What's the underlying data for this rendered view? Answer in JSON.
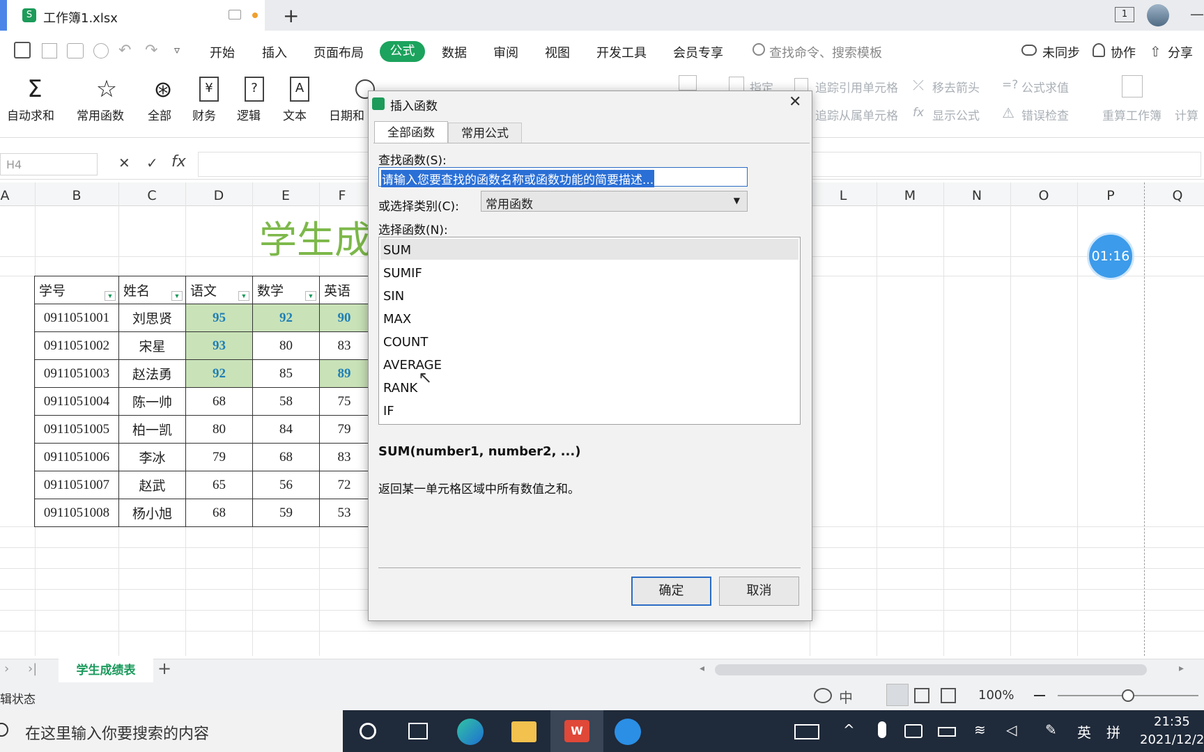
{
  "app": {
    "doc_badge": "S",
    "file_name": "工作簿1.xlsx",
    "new_tab": "+"
  },
  "title_right": {
    "page_indicator": "1",
    "minimize": "—"
  },
  "menu": {
    "items": [
      "开始",
      "插入",
      "页面布局",
      "公式",
      "数据",
      "审阅",
      "视图",
      "开发工具",
      "会员专享"
    ],
    "active": "公式",
    "search_placeholder": "查找命令、搜索模板",
    "right": [
      "未同步",
      "协作",
      "分享"
    ]
  },
  "ribbon": {
    "buttons": [
      "自动求和",
      "常用函数",
      "全部",
      "财务",
      "逻辑",
      "文本",
      "日期和"
    ],
    "gray_items": [
      "指定",
      "追踪引用单元格",
      "移去箭头",
      "公式求值",
      "追踪从属单元格",
      "显示公式",
      "错误检查",
      "重算工作簿",
      "计算"
    ]
  },
  "formula_bar": {
    "name_box": "H4",
    "cancel": "✕",
    "confirm": "✓",
    "fx": "fx"
  },
  "columns": [
    "A",
    "B",
    "C",
    "D",
    "E",
    "F",
    "L",
    "M",
    "N",
    "O",
    "P",
    "Q"
  ],
  "sheet": {
    "title": "学生成",
    "headers": [
      "学号",
      "姓名",
      "语文",
      "数学",
      "英语"
    ],
    "rows": [
      [
        "0911051001",
        "刘思贤",
        "95",
        "92",
        "90"
      ],
      [
        "0911051002",
        "宋星",
        "93",
        "80",
        "83"
      ],
      [
        "0911051003",
        "赵法勇",
        "92",
        "85",
        "89"
      ],
      [
        "0911051004",
        "陈一帅",
        "68",
        "58",
        "75"
      ],
      [
        "0911051005",
        "柏一凯",
        "80",
        "84",
        "79"
      ],
      [
        "0911051006",
        "李冰",
        "79",
        "68",
        "83"
      ],
      [
        "0911051007",
        "赵武",
        "65",
        "56",
        "72"
      ],
      [
        "0911051008",
        "杨小旭",
        "68",
        "59",
        "53"
      ]
    ]
  },
  "sheet_tabs": {
    "active": "学生成绩表",
    "add": "+"
  },
  "status": {
    "left": "辑状态",
    "zoom": "100%"
  },
  "timer": "01:16",
  "dialog": {
    "title": "插入函数",
    "close": "✕",
    "tabs": [
      "全部函数",
      "常用公式"
    ],
    "search_label": "查找函数(S):",
    "search_value": "请输入您要查找的函数名称或函数功能的简要描述...",
    "category_label": "或选择类别(C):",
    "category_value": "常用函数",
    "list_label": "选择函数(N):",
    "functions": [
      "SUM",
      "SUMIF",
      "SIN",
      "MAX",
      "COUNT",
      "AVERAGE",
      "RANK",
      "IF"
    ],
    "selected": "SUM",
    "signature": "SUM(number1, number2, ...)",
    "description": "返回某一单元格区域中所有数值之和。",
    "ok": "确定",
    "cancel": "取消"
  },
  "taskbar": {
    "search_placeholder": "在这里输入你要搜索的内容",
    "time": "21:35",
    "date": "2021/12/2",
    "ime1": "英",
    "ime2": "拼"
  }
}
